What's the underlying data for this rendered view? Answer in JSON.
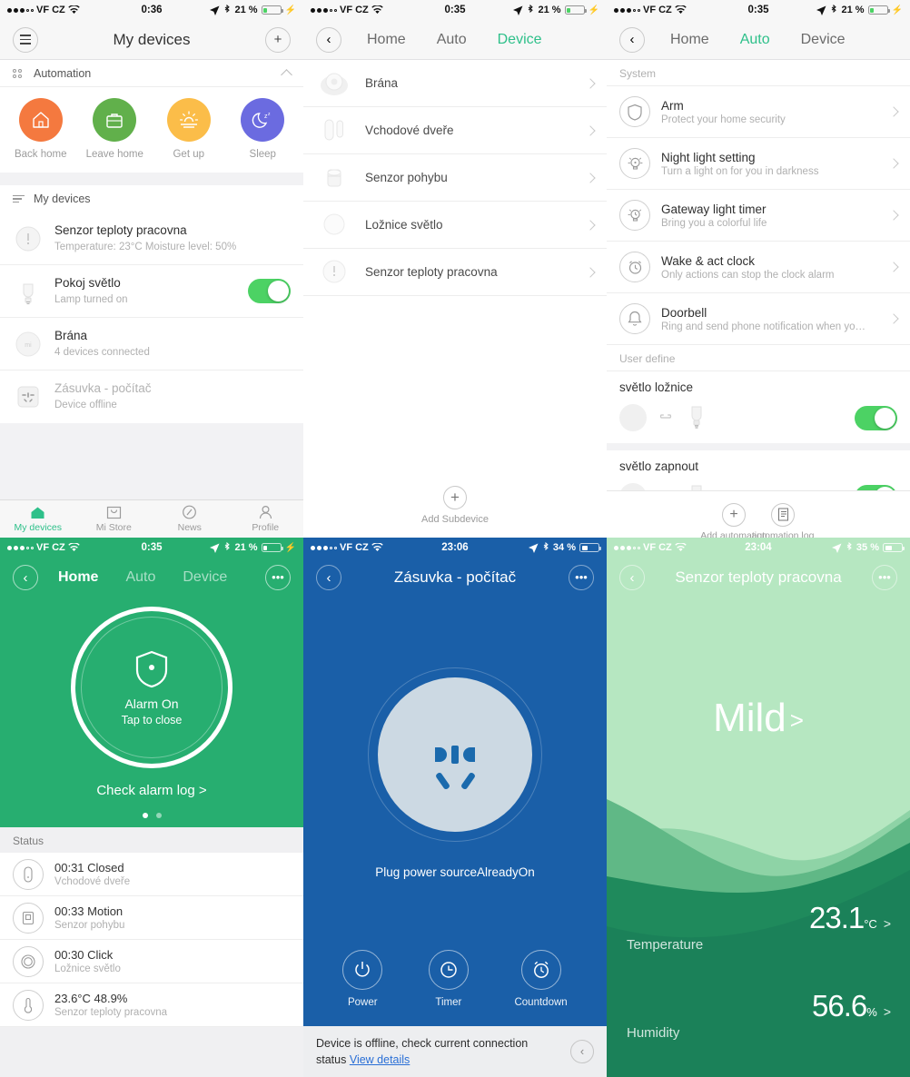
{
  "panel1": {
    "statusbar": {
      "carrier": "VF CZ",
      "time": "0:36",
      "battery": "21 %"
    },
    "nav": {
      "title": "My devices",
      "menu_icon": "hamburger-icon",
      "add_icon": "plus-icon"
    },
    "automation_section": {
      "label": "Automation",
      "collapse_icon": "chevron-up-icon"
    },
    "scenes": [
      {
        "label": "Back home",
        "color": "#f4793f",
        "icon": "home-icon"
      },
      {
        "label": "Leave home",
        "color": "#61b04b",
        "icon": "briefcase-icon"
      },
      {
        "label": "Get up",
        "color": "#fbbd49",
        "icon": "sunrise-icon"
      },
      {
        "label": "Sleep",
        "color": "#6b6be0",
        "icon": "moon-icon"
      }
    ],
    "devices_section": {
      "label": "My devices"
    },
    "devices": [
      {
        "name": "Senzor teploty pracovna",
        "status": "Temperature: 23°C Moisture level: 50%",
        "icon": "temp-sensor-icon",
        "toggle": false,
        "offline": false
      },
      {
        "name": "Pokoj světlo",
        "status": "Lamp turned on",
        "icon": "bulb-icon",
        "toggle": true,
        "offline": false
      },
      {
        "name": "Brána",
        "status": "4 devices connected",
        "icon": "gateway-icon",
        "toggle": false,
        "offline": false
      },
      {
        "name": "Zásuvka - počítač",
        "status": "Device offline",
        "icon": "socket-icon",
        "toggle": false,
        "offline": true
      }
    ],
    "tabbar": [
      {
        "label": "My devices",
        "icon": "home-icon",
        "active": true
      },
      {
        "label": "Mi Store",
        "icon": "bag-icon",
        "active": false
      },
      {
        "label": "News",
        "icon": "compass-icon",
        "active": false
      },
      {
        "label": "Profile",
        "icon": "person-icon",
        "active": false
      }
    ]
  },
  "panel2": {
    "statusbar": {
      "carrier": "VF CZ",
      "time": "0:35",
      "battery": "21 %"
    },
    "nav": {
      "back_icon": "chevron-left-icon",
      "tabs": [
        {
          "label": "Home",
          "active": false
        },
        {
          "label": "Auto",
          "active": false
        },
        {
          "label": "Device",
          "active": true
        }
      ]
    },
    "subdevices": [
      {
        "name": "Brána",
        "icon": "gateway-icon"
      },
      {
        "name": "Vchodové dveře",
        "icon": "door-sensor-icon"
      },
      {
        "name": "Senzor pohybu",
        "icon": "motion-sensor-icon"
      },
      {
        "name": "Ložnice světlo",
        "icon": "button-icon"
      },
      {
        "name": "Senzor teploty pracovna",
        "icon": "temp-sensor-icon"
      }
    ],
    "add_subdevice": {
      "label": "Add Subdevice",
      "icon": "plus-icon"
    }
  },
  "panel3": {
    "statusbar": {
      "carrier": "VF CZ",
      "time": "0:35",
      "battery": "21 %"
    },
    "nav": {
      "back_icon": "chevron-left-icon",
      "tabs": [
        {
          "label": "Home",
          "active": false
        },
        {
          "label": "Auto",
          "active": true
        },
        {
          "label": "Device",
          "active": false
        }
      ]
    },
    "system_label": "System",
    "system_items": [
      {
        "title": "Arm",
        "subtitle": "Protect your home security",
        "icon": "shield-icon"
      },
      {
        "title": "Night light setting",
        "subtitle": "Turn a light on for you in darkness",
        "icon": "nightlight-icon"
      },
      {
        "title": "Gateway light timer",
        "subtitle": "Bring you a colorful life",
        "icon": "light-timer-icon"
      },
      {
        "title": "Wake & act clock",
        "subtitle": "Only actions can stop the clock alarm",
        "icon": "alarm-clock-icon"
      },
      {
        "title": "Doorbell",
        "subtitle": "Ring and send phone notification when yo…",
        "icon": "bell-icon"
      }
    ],
    "user_define_label": "User define",
    "user_automations": [
      {
        "name": "světlo ložnice",
        "enabled": true,
        "from_icon": "gateway-icon",
        "link_icon": "link-icon",
        "to_icon": "bulb-icon"
      },
      {
        "name": "světlo zapnout",
        "enabled": true,
        "from_icon": "gateway-icon",
        "link_icon": "link-icon",
        "to_icon": "bulb-icon"
      }
    ],
    "footer": [
      {
        "label": "Add automation",
        "icon": "plus-icon"
      },
      {
        "label": "automation log",
        "icon": "document-icon"
      }
    ]
  },
  "panel4": {
    "statusbar": {
      "carrier": "VF CZ",
      "time": "0:35",
      "battery": "21 %"
    },
    "nav": {
      "back_icon": "chevron-left-icon",
      "more_icon": "ellipsis-icon",
      "tabs": [
        {
          "label": "Home",
          "active": true
        },
        {
          "label": "Auto",
          "active": false
        },
        {
          "label": "Device",
          "active": false
        }
      ]
    },
    "alarm": {
      "title": "Alarm On",
      "hint": "Tap to close",
      "icon": "shield-dot-icon",
      "log_link": "Check alarm log >",
      "page_count": 2,
      "page_active": 0
    },
    "status_label": "Status",
    "status_items": [
      {
        "title": "00:31 Closed",
        "subtitle": "Vchodové dveře",
        "icon": "door-sensor-icon"
      },
      {
        "title": "00:33 Motion",
        "subtitle": "Senzor pohybu",
        "icon": "motion-sensor-icon"
      },
      {
        "title": "00:30 Click",
        "subtitle": "Ložnice světlo",
        "icon": "button-icon"
      },
      {
        "title": "23.6°C 48.9%",
        "subtitle": "Senzor teploty pracovna",
        "icon": "thermometer-icon"
      }
    ],
    "accent": "#27ae70"
  },
  "panel5": {
    "statusbar": {
      "carrier": "VF CZ",
      "time": "23:06",
      "battery": "34 %"
    },
    "nav": {
      "back_icon": "chevron-left-icon",
      "title": "Zásuvka - počítač",
      "more_icon": "ellipsis-icon"
    },
    "socket": {
      "caption": "Plug power sourceAlreadyOn",
      "icon": "power-socket-icon"
    },
    "controls": [
      {
        "label": "Power",
        "icon": "power-icon"
      },
      {
        "label": "Timer",
        "icon": "clock-icon"
      },
      {
        "label": "Countdown",
        "icon": "alarm-clock-icon"
      }
    ],
    "offline": {
      "text": "Device is offline, check current connection status ",
      "link": "View details",
      "collapse_icon": "chevron-left-circle-icon"
    },
    "accent": "#1a5fa8"
  },
  "panel6": {
    "statusbar": {
      "carrier": "VF CZ",
      "time": "23:04",
      "battery": "35 %"
    },
    "nav": {
      "back_icon": "chevron-left-icon",
      "title": "Senzor teploty pracovna",
      "more_icon": "ellipsis-icon"
    },
    "mood": "Mild",
    "mood_arrow": ">",
    "readings": [
      {
        "label": "Temperature",
        "value": "23.1",
        "unit": "°C",
        "arrow": ">"
      },
      {
        "label": "Humidity",
        "value": "56.6",
        "unit": "%",
        "arrow": ">"
      }
    ],
    "accent": "#b6e7c1"
  }
}
